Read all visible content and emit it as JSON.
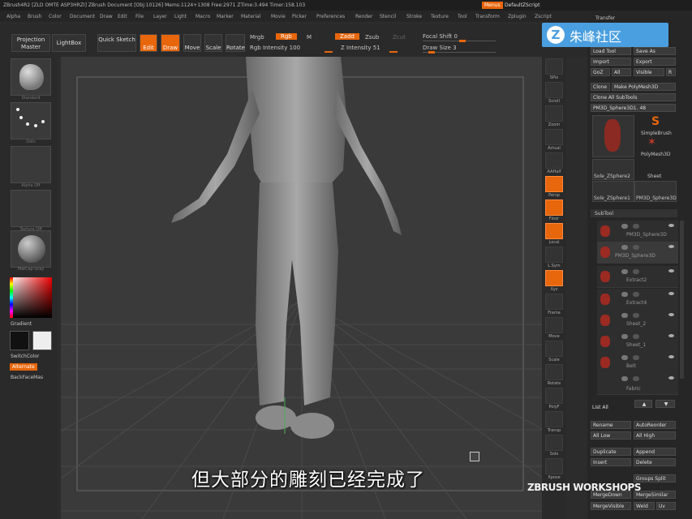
{
  "titlebar": {
    "text": "ZBrush4R2 [ZLD OMTE ASP3HRZI]   ZBrush Document   [Obj:10126] Mems:1124+1308 Free:2971 ZTime:3.494 Timer:158.103",
    "menus_label": "Menus",
    "script_label": "DefaultZScript"
  },
  "menubar": [
    "Alpha",
    "Brush",
    "Color",
    "Document",
    "Draw",
    "Edit",
    "File",
    "Layer",
    "Light",
    "Macro",
    "Marker",
    "Material",
    "Movie",
    "Picker",
    "Preferences",
    "Render",
    "Stencil",
    "Stroke",
    "Texture",
    "Tool",
    "Transform",
    "Zplugin",
    "Zscript"
  ],
  "toolbar": {
    "projection_master": "Projection Master",
    "lightbox": "LightBox",
    "quick_sketch": "Quick Sketch",
    "edit": "Edit",
    "draw": "Draw",
    "move": "Move",
    "scale": "Scale",
    "rotate": "Rotate",
    "mrgb": "Mrgb",
    "rgb": "Rgb",
    "m": "M",
    "rgb_intensity": "Rgb Intensity 100",
    "zadd": "Zadd",
    "zsub": "Zsub",
    "zcut": "Zcut",
    "z_intensity": "Z Intensity 51",
    "focal_shift": "Focal Shift 0",
    "draw_size": "Draw Size 3"
  },
  "leftshelf": {
    "labels": [
      "Standard",
      "Dots",
      "Alpha Off",
      "Texture Off",
      "MatCap Gray"
    ],
    "gradient": "Gradient",
    "switch_color": "SwitchColor",
    "alternate": "Alternate",
    "backfacemask": "BackFaceMas"
  },
  "rightshelf": [
    "SPix",
    "Scroll",
    "Zoom",
    "Actual",
    "AAHalf",
    "Persp",
    "Floor",
    "Local",
    "L.Sym",
    "Xyz",
    "Frame",
    "Move",
    "Scale",
    "Rotate",
    "PolyF",
    "Transp",
    "Solo",
    "Xpose"
  ],
  "panel": {
    "transfer": "Transfer",
    "load_tool": "Load Tool",
    "save_as": "Save As",
    "import": "Import",
    "export": "Export",
    "goz": "GoZ",
    "all": "All",
    "visible": "Visible",
    "r": "R",
    "clone": "Clone",
    "make_polymesh": "Make PolyMesh3D",
    "clone_all": "Clone All SubTools",
    "current_tool": "PM3D_Sphere3D1. 48",
    "tools": [
      "PM3D_Sphere3D",
      "SimpleBrush",
      "PolyMesh3D",
      "Sole_ZSphere2",
      "Sheet",
      "Sole_ZSphere1",
      "PM3D_Sphere3D"
    ],
    "subtool_header": "SubTool",
    "subtools": [
      "PM3D_Sphere3D",
      "PM3D_Sphere3D",
      "Extract2",
      "Extract4",
      "Sheet_2",
      "Sheet_1",
      "Belt",
      "Fabric"
    ],
    "list_all": "List All",
    "rename": "Rename",
    "autoreorder": "AutoReorder",
    "all_low": "All Low",
    "all_high": "All High",
    "duplicate": "Duplicate",
    "append": "Append",
    "insert": "Insert",
    "delete": "Delete",
    "groups_split": "Groups Split",
    "mergedown": "MergeDown",
    "mergesimilar": "MergeSimilar",
    "mergevisible": "MergeVisible",
    "weld": "Weld",
    "uv": "Uv"
  },
  "watermark": {
    "logo_text": "朱峰社区",
    "brand": "ZBRUSH WORKSHOPS"
  },
  "subtitle": "但大部分的雕刻已经完成了"
}
